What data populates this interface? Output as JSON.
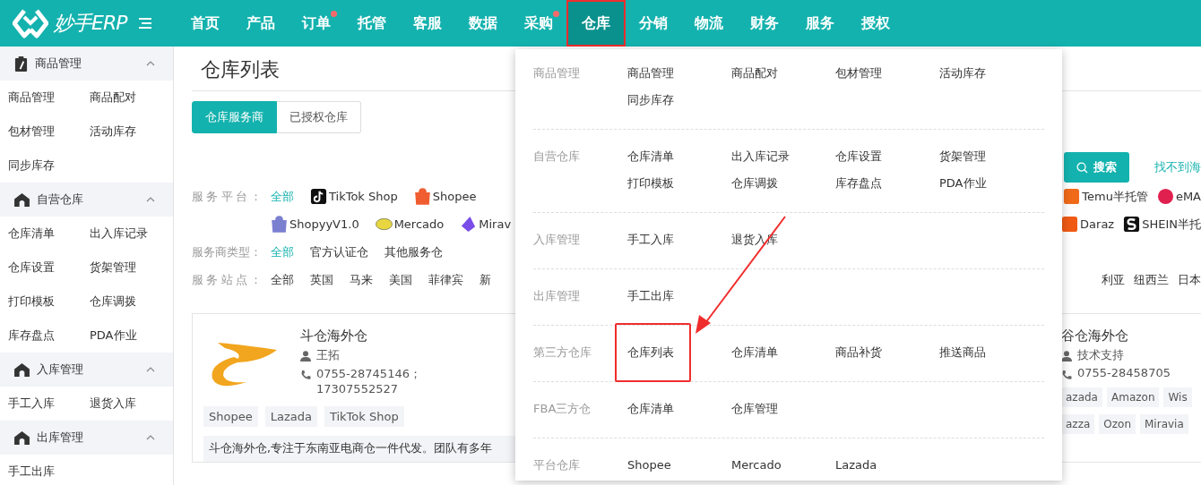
{
  "header": {
    "logo_text": "妙手ERP",
    "nav": [
      {
        "label": "首页",
        "selected": false,
        "badge": false,
        "highlighted": false
      },
      {
        "label": "产品",
        "selected": false,
        "badge": false,
        "highlighted": false
      },
      {
        "label": "订单",
        "selected": false,
        "badge": true,
        "highlighted": false
      },
      {
        "label": "托管",
        "selected": false,
        "badge": false,
        "highlighted": false
      },
      {
        "label": "客服",
        "selected": false,
        "badge": false,
        "highlighted": false
      },
      {
        "label": "数据",
        "selected": false,
        "badge": false,
        "highlighted": false
      },
      {
        "label": "采购",
        "selected": false,
        "badge": true,
        "highlighted": false
      },
      {
        "label": "仓库",
        "selected": true,
        "badge": false,
        "highlighted": true
      },
      {
        "label": "分销",
        "selected": false,
        "badge": false,
        "highlighted": false
      },
      {
        "label": "物流",
        "selected": false,
        "badge": false,
        "highlighted": false
      },
      {
        "label": "财务",
        "selected": false,
        "badge": false,
        "highlighted": false
      },
      {
        "label": "服务",
        "selected": false,
        "badge": false,
        "highlighted": false
      },
      {
        "label": "授权",
        "selected": false,
        "badge": false,
        "highlighted": false
      }
    ]
  },
  "sidebar": {
    "groups": [
      {
        "title": "商品管理",
        "kind": "clipboard",
        "expanded": true,
        "items": [
          "商品管理",
          "商品配对",
          "包材管理",
          "活动库存",
          "同步库存"
        ]
      },
      {
        "title": "自营仓库",
        "kind": "house",
        "expanded": true,
        "items": [
          "仓库清单",
          "出入库记录",
          "仓库设置",
          "货架管理",
          "打印模板",
          "仓库调拨",
          "库存盘点",
          "PDA作业"
        ]
      },
      {
        "title": "入库管理",
        "kind": "house",
        "expanded": true,
        "items": [
          "手工入库",
          "退货入库"
        ]
      },
      {
        "title": "出库管理",
        "kind": "house",
        "expanded": true,
        "items": [
          "手工出库"
        ]
      }
    ]
  },
  "page": {
    "title": "仓库列表",
    "tabs": [
      {
        "label": "仓库服务商",
        "selected": true
      },
      {
        "label": "已授权仓库",
        "selected": false
      }
    ],
    "search_button": "搜索",
    "help_link": "找不到海"
  },
  "filters": [
    {
      "label": "服务平台：",
      "lines": [
        {
          "left": [
            {
              "label": "全部",
              "selected": true
            },
            {
              "label": "TikTok Shop",
              "kind": "tiktok",
              "selected": false
            },
            {
              "label": "Shopee",
              "kind": "shopee",
              "selected": false
            }
          ],
          "right": [
            {
              "label": "Temu半托管",
              "kind": "temu",
              "selected": false
            },
            {
              "label": "eMA",
              "kind": "emag",
              "selected": false
            }
          ]
        },
        {
          "left": [
            {
              "label": "ShopyyV1.0",
              "kind": "shopyy",
              "selected": false
            },
            {
              "label": "Mercado",
              "kind": "mercado",
              "selected": false
            },
            {
              "label": "Mirav",
              "kind": "miravia",
              "selected": false
            }
          ],
          "right": [
            {
              "label": "Daraz",
              "kind": "daraz",
              "selected": false
            },
            {
              "label": "SHEIN半托",
              "kind": "shein",
              "selected": false
            }
          ]
        }
      ]
    },
    {
      "label": "服务商类型：",
      "lines": [
        {
          "left": [
            {
              "label": "全部",
              "selected": true
            },
            {
              "label": "官方认证仓",
              "selected": false
            },
            {
              "label": "其他服务仓",
              "selected": false
            }
          ]
        }
      ]
    },
    {
      "label": "服务站点：",
      "lines": [
        {
          "left": [
            {
              "label": "全部",
              "selected": false
            },
            {
              "label": "英国",
              "selected": false
            },
            {
              "label": "马来",
              "selected": false
            },
            {
              "label": "美国",
              "selected": false
            },
            {
              "label": "菲律宾",
              "selected": false
            },
            {
              "label": "新",
              "selected": false
            }
          ],
          "right": [
            {
              "label": "利亚",
              "selected": false
            },
            {
              "label": "纽西兰",
              "selected": false
            },
            {
              "label": "日本",
              "selected": false
            }
          ]
        }
      ]
    }
  ],
  "cards": [
    {
      "logo": true,
      "name": "斗仓海外仓",
      "contact": "王拓",
      "phone": "0755-28745146；17307552527",
      "tag_rows": [
        [
          "Shopee",
          "Lazada",
          "TikTok Shop"
        ]
      ],
      "description": "斗仓海外仓,专注于东南亚电商仓一件代发。团队有多年"
    },
    {
      "logo": false,
      "name": "谷仓海外仓",
      "contact": "技术支持",
      "phone": "0755-28458705",
      "tag_rows": [
        [
          "azada",
          "Amazon",
          "Wis"
        ],
        [
          "azza",
          "Ozon",
          "Miravia"
        ]
      ]
    }
  ],
  "menu": {
    "sections": [
      {
        "title": "商品管理",
        "items": [
          {
            "label": "商品管理",
            "highlighted": false
          },
          {
            "label": "商品配对",
            "highlighted": false
          },
          {
            "label": "包材管理",
            "highlighted": false
          },
          {
            "label": "活动库存",
            "highlighted": false
          },
          {
            "label": "同步库存",
            "highlighted": false
          }
        ]
      },
      {
        "title": "自营仓库",
        "items": [
          {
            "label": "仓库清单",
            "highlighted": false
          },
          {
            "label": "出入库记录",
            "highlighted": false
          },
          {
            "label": "仓库设置",
            "highlighted": false
          },
          {
            "label": "货架管理",
            "highlighted": false
          },
          {
            "label": "打印模板",
            "highlighted": false
          },
          {
            "label": "仓库调拨",
            "highlighted": false
          },
          {
            "label": "库存盘点",
            "highlighted": false
          },
          {
            "label": "PDA作业",
            "highlighted": false
          }
        ]
      },
      {
        "title": "入库管理",
        "items": [
          {
            "label": "手工入库",
            "highlighted": false
          },
          {
            "label": "退货入库",
            "highlighted": false
          }
        ]
      },
      {
        "title": "出库管理",
        "items": [
          {
            "label": "手工出库",
            "highlighted": false
          }
        ]
      },
      {
        "title": "第三方仓库",
        "items": [
          {
            "label": "仓库列表",
            "highlighted": true
          },
          {
            "label": "仓库清单",
            "highlighted": false
          },
          {
            "label": "商品补货",
            "highlighted": false
          },
          {
            "label": "推送商品",
            "highlighted": false
          }
        ]
      },
      {
        "title": "FBA三方仓",
        "items": [
          {
            "label": "仓库清单",
            "highlighted": false
          },
          {
            "label": "仓库管理",
            "highlighted": false
          }
        ]
      },
      {
        "title": "平台仓库",
        "items": [
          {
            "label": "Shopee",
            "highlighted": false
          },
          {
            "label": "Mercado",
            "highlighted": false
          },
          {
            "label": "Lazada",
            "highlighted": false
          }
        ]
      }
    ]
  }
}
